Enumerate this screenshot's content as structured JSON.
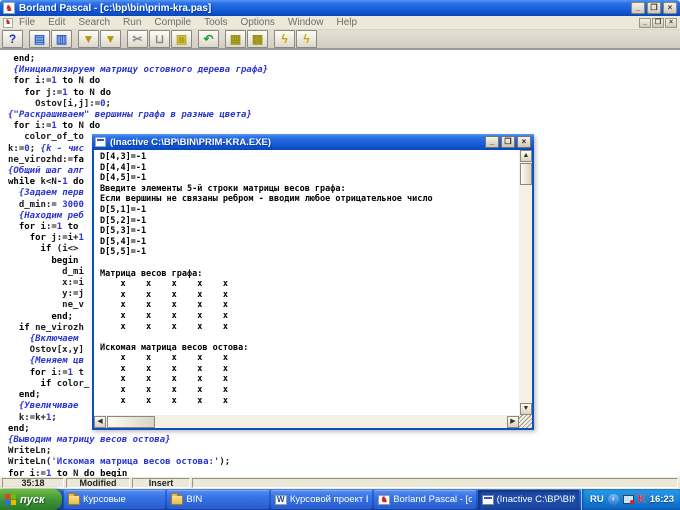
{
  "window": {
    "title": "Borland Pascal - [c:\\bp\\bin\\prim-kra.pas]"
  },
  "menu": {
    "items": [
      "File",
      "Edit",
      "Search",
      "Run",
      "Compile",
      "Tools",
      "Options",
      "Window",
      "Help"
    ]
  },
  "window_buttons": {
    "minimize": "_",
    "restore": "❐",
    "close": "×"
  },
  "toolbar": {
    "buttons": [
      {
        "name": "help-button",
        "glyph": "?",
        "color": "#2430c8",
        "gap": false
      },
      {
        "name": "open-file-button",
        "glyph": "▤",
        "color": "#2a5fd0",
        "gap": true
      },
      {
        "name": "save-file-button",
        "glyph": "▥",
        "color": "#2a5fd0",
        "gap": false
      },
      {
        "name": "search-button",
        "glyph": "▼",
        "color": "#b99413",
        "gap": true
      },
      {
        "name": "search-replace-button",
        "glyph": "▼",
        "color": "#b99413",
        "gap": false
      },
      {
        "name": "cut-button",
        "glyph": "✂",
        "color": "#8a8a8a",
        "gap": true
      },
      {
        "name": "clipboard-button",
        "glyph": "⊔",
        "color": "#8a8a8a",
        "gap": false
      },
      {
        "name": "copy-button",
        "glyph": "▣",
        "color": "#b9a413",
        "gap": false
      },
      {
        "name": "undo-button",
        "glyph": "↶",
        "color": "#1f9e2c",
        "gap": true
      },
      {
        "name": "tile-windows-button",
        "glyph": "▦",
        "color": "#9a8f12",
        "gap": true
      },
      {
        "name": "cascade-windows-button",
        "glyph": "▩",
        "color": "#9a8f12",
        "gap": false
      },
      {
        "name": "compile-button",
        "glyph": "ϟ",
        "color": "#c9a50a",
        "gap": true
      },
      {
        "name": "run-button",
        "glyph": "ϟ",
        "color": "#c9a50a",
        "gap": false
      }
    ]
  },
  "editor": {
    "lines": [
      [
        [
          "p",
          " "
        ],
        [
          "k",
          "end"
        ],
        [
          "p",
          ";"
        ]
      ],
      [
        [
          "p",
          " "
        ],
        [
          "c",
          "{Инициализируем матрицу остовного дерева графа}"
        ]
      ],
      [
        [
          "p",
          " "
        ],
        [
          "k",
          "for"
        ],
        [
          "p",
          " i:="
        ],
        [
          "n",
          "1"
        ],
        [
          "p",
          " "
        ],
        [
          "k",
          "to"
        ],
        [
          "p",
          " N "
        ],
        [
          "k",
          "do"
        ]
      ],
      [
        [
          "p",
          "   "
        ],
        [
          "k",
          "for"
        ],
        [
          "p",
          " j:="
        ],
        [
          "n",
          "1"
        ],
        [
          "p",
          " "
        ],
        [
          "k",
          "to"
        ],
        [
          "p",
          " N "
        ],
        [
          "k",
          "do"
        ]
      ],
      [
        [
          "p",
          "     Ostov[i,j]:="
        ],
        [
          "n",
          "0"
        ],
        [
          "p",
          ";"
        ]
      ],
      [
        [
          "c",
          "{\"Раскрашиваем\" вершины графа в разные цвета}"
        ]
      ],
      [
        [
          "p",
          " "
        ],
        [
          "k",
          "for"
        ],
        [
          "p",
          " i:="
        ],
        [
          "n",
          "1"
        ],
        [
          "p",
          " "
        ],
        [
          "k",
          "to"
        ],
        [
          "p",
          " N "
        ],
        [
          "k",
          "do"
        ]
      ],
      [
        [
          "p",
          "   color_of_to"
        ]
      ],
      [
        [
          "p",
          "k:="
        ],
        [
          "n",
          "0"
        ],
        [
          "p",
          "; "
        ],
        [
          "c",
          "{k - чис"
        ]
      ],
      [
        [
          "p",
          "ne_virozhd:="
        ],
        [
          "k",
          "fa"
        ]
      ],
      [
        [
          "c",
          "{Общий шаг алг"
        ]
      ],
      [
        [
          "k",
          "while"
        ],
        [
          "p",
          " k<N-"
        ],
        [
          "n",
          "1"
        ],
        [
          "p",
          " "
        ],
        [
          "k",
          "do"
        ]
      ],
      [
        [
          "p",
          "  "
        ],
        [
          "c",
          "{Задаем перв"
        ]
      ],
      [
        [
          "p",
          "  d_min:= "
        ],
        [
          "n",
          "3000"
        ]
      ],
      [
        [
          "p",
          "  "
        ],
        [
          "c",
          "{Находим реб"
        ]
      ],
      [
        [
          "p",
          "  "
        ],
        [
          "k",
          "for"
        ],
        [
          "p",
          " i:="
        ],
        [
          "n",
          "1"
        ],
        [
          "p",
          " "
        ],
        [
          "k",
          "to"
        ]
      ],
      [
        [
          "p",
          "    "
        ],
        [
          "k",
          "for"
        ],
        [
          "p",
          " j:=i+"
        ],
        [
          "n",
          "1"
        ]
      ],
      [
        [
          "p",
          "      "
        ],
        [
          "k",
          "if"
        ],
        [
          "p",
          " (i<>"
        ]
      ],
      [
        [
          "p",
          "        "
        ],
        [
          "k",
          "begin"
        ]
      ],
      [
        [
          "p",
          "          d_mi"
        ]
      ],
      [
        [
          "p",
          "          x:=i"
        ]
      ],
      [
        [
          "p",
          "          y:=j"
        ]
      ],
      [
        [
          "p",
          "          ne_v"
        ]
      ],
      [
        [
          "p",
          "        "
        ],
        [
          "k",
          "end"
        ],
        [
          "p",
          ";"
        ]
      ],
      [
        [
          "p",
          "  "
        ],
        [
          "k",
          "if"
        ],
        [
          "p",
          " ne_virozh"
        ]
      ],
      [
        [
          "p",
          "    "
        ],
        [
          "c",
          "{Включаем"
        ]
      ],
      [
        [
          "p",
          "    Ostov[x,y]"
        ]
      ],
      [
        [
          "p",
          "    "
        ],
        [
          "c",
          "{Меняем цв"
        ]
      ],
      [
        [
          "p",
          "    "
        ],
        [
          "k",
          "for"
        ],
        [
          "p",
          " i:="
        ],
        [
          "n",
          "1"
        ],
        [
          "p",
          " t"
        ]
      ],
      [
        [
          "p",
          "      "
        ],
        [
          "k",
          "if"
        ],
        [
          "p",
          " color_"
        ]
      ],
      [
        [
          "p",
          "  "
        ],
        [
          "k",
          "end"
        ],
        [
          "p",
          ";"
        ]
      ],
      [
        [
          "p",
          "  "
        ],
        [
          "c",
          "{Увеличивае"
        ]
      ],
      [
        [
          "p",
          "  k:=k+"
        ],
        [
          "n",
          "1"
        ],
        [
          "p",
          ";"
        ]
      ],
      [
        [
          "k",
          "end"
        ],
        [
          "p",
          ";"
        ]
      ],
      [
        [
          "c",
          "{Выводим матрицу весов остова}"
        ]
      ],
      [
        [
          "p",
          "WriteLn;"
        ]
      ],
      [
        [
          "p",
          "WriteLn("
        ],
        [
          "s",
          "'Искомая матрица весов остова:'"
        ],
        [
          "p",
          ");"
        ]
      ],
      [
        [
          "k",
          "for"
        ],
        [
          "p",
          " i:="
        ],
        [
          "n",
          "1"
        ],
        [
          "p",
          " "
        ],
        [
          "k",
          "to"
        ],
        [
          "p",
          " N "
        ],
        [
          "k",
          "do"
        ],
        [
          "p",
          " "
        ],
        [
          "k",
          "begin"
        ]
      ]
    ]
  },
  "status": {
    "cells": [
      "35:18",
      "Modified",
      "Insert",
      ""
    ]
  },
  "console": {
    "title": "(Inactive C:\\BP\\BIN\\PRIM-KRA.EXE)",
    "lines": [
      "D[4,3]=-1",
      "D[4,4]=-1",
      "D[4,5]=-1",
      "Введите элементы 5-й строки матрицы весов графа:",
      "Если вершины не связаны ребром - вводим любое отрицательное число",
      "D[5,1]=-1",
      "D[5,2]=-1",
      "D[5,3]=-1",
      "D[5,4]=-1",
      "D[5,5]=-1",
      "",
      "Матрица весов графа:",
      "    x    x    x    x    x",
      "    x    x    x    x    x",
      "    x    x    x    x    x",
      "    x    x    x    x    x",
      "    x    x    x    x    x",
      "",
      "Искомая матрица весов остова:",
      "    x    x    x    x    x",
      "    x    x    x    x    x",
      "    x    x    x    x    x",
      "    x    x    x    x    x",
      "    x    x    x    x    x"
    ]
  },
  "taskbar": {
    "start_label": "пуск",
    "items": [
      {
        "label": "Курсовые",
        "icon": "folder",
        "glyph": "",
        "active": false
      },
      {
        "label": "BIN",
        "icon": "folder",
        "glyph": "",
        "active": false
      },
      {
        "label": "Курсовой проект Б...",
        "icon": "word",
        "glyph": "W",
        "active": false
      },
      {
        "label": "Borland Pascal - [c:\\...",
        "icon": "borland",
        "glyph": "♞",
        "active": false
      },
      {
        "label": "(Inactive C:\\BP\\BIN\\...",
        "icon": "console-ic",
        "glyph": "",
        "active": true
      }
    ],
    "tray": {
      "lang": "RU",
      "chevron": "‹",
      "kaspersky": "K",
      "time": "16:23"
    }
  }
}
